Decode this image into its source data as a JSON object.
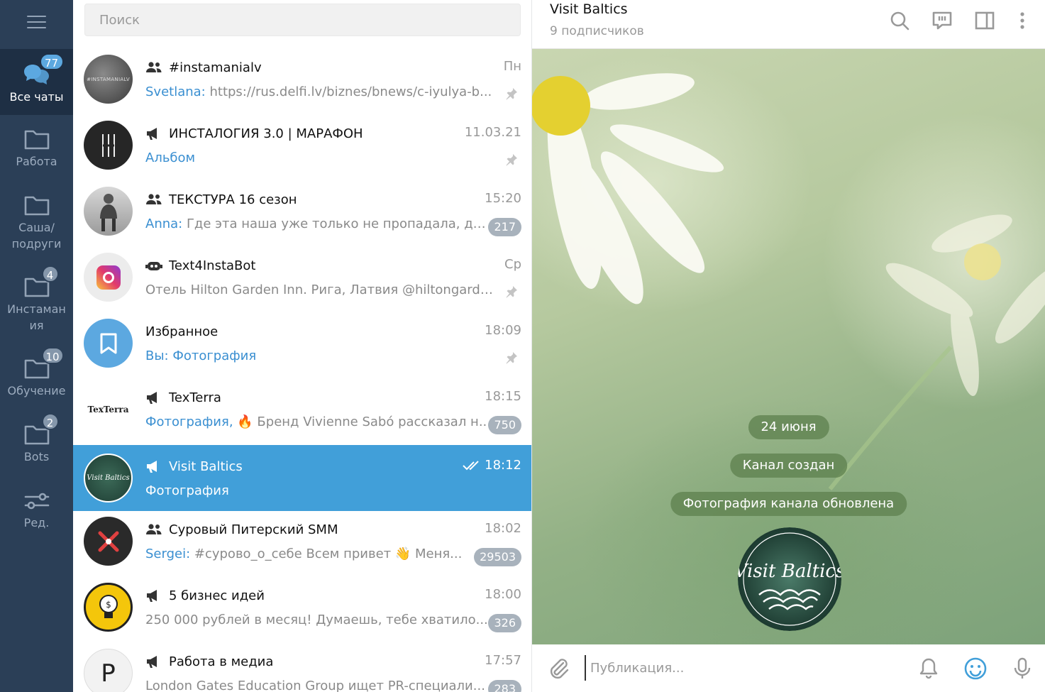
{
  "sidebar": {
    "folders": [
      {
        "label": "Все чаты",
        "badge": "77",
        "icon": "chats-icon"
      },
      {
        "label": "Работа",
        "badge": "",
        "icon": "folder-icon"
      },
      {
        "label": "Саша/ подруги",
        "badge": "",
        "icon": "folder-icon"
      },
      {
        "label": "Инстаман ия",
        "badge": "4",
        "icon": "folder-icon"
      },
      {
        "label": "Обучение",
        "badge": "10",
        "icon": "folder-icon"
      },
      {
        "label": "Bots",
        "badge": "2",
        "icon": "folder-icon"
      },
      {
        "label": "Ред.",
        "badge": "",
        "icon": "edit-folders-icon"
      }
    ]
  },
  "search": {
    "placeholder": "Поиск"
  },
  "chats": [
    {
      "title": "#instamanialv",
      "type": "group",
      "time": "Пн",
      "from": "Svetlana:",
      "preview": " https://rus.delfi.lv/biznes/bnews/c-iyulya-b...",
      "pinned": true,
      "unread": ""
    },
    {
      "title": "ИНСТАЛОГИЯ 3.0 | МАРАФОН",
      "type": "channel",
      "time": "11.03.21",
      "from": "Альбом",
      "preview": "",
      "pinned": true,
      "unread": ""
    },
    {
      "title": "ТЕКСТУРА 16 сезон",
      "type": "group",
      "time": "15:20",
      "from": "Anna:",
      "preview": " Где эта наша уже только не пропадала, да ...",
      "pinned": false,
      "unread": "217"
    },
    {
      "title": "Text4InstaBot",
      "type": "bot",
      "time": "Ср",
      "from": "",
      "preview": "Отель Hilton Garden Inn. Рига, Латвия @hiltongarde...",
      "pinned": true,
      "unread": ""
    },
    {
      "title": "Избранное",
      "type": "saved",
      "time": "18:09",
      "from": "Вы: Фотография",
      "preview": "",
      "pinned": true,
      "unread": ""
    },
    {
      "title": "TexTerra",
      "type": "channel",
      "time": "18:15",
      "from": "Фотография,",
      "preview": " 🔥 Бренд Vivienne Sabó рассказал н...",
      "pinned": false,
      "unread": "750"
    },
    {
      "title": "Visit Baltics",
      "type": "channel",
      "time": "18:12",
      "from": "",
      "preview": "Фотография",
      "pinned": false,
      "unread": "",
      "selected": true
    },
    {
      "title": "Суровый Питерский SMM",
      "type": "group",
      "time": "18:02",
      "from": "Sergei:",
      "preview": " #сурово_о_себе  Всем привет 👋  Меня...",
      "pinned": false,
      "unread": "29503"
    },
    {
      "title": "5 бизнес идей",
      "type": "channel",
      "time": "18:00",
      "from": "",
      "preview": "250 000 рублей в месяц!  Думаешь, тебе хватило...",
      "pinned": false,
      "unread": "326"
    },
    {
      "title": "Работа в медиа",
      "type": "channel",
      "time": "17:57",
      "from": "",
      "preview": "London Gates Education Group ищет PR-специали...",
      "pinned": false,
      "unread": "283"
    }
  ],
  "avatars": {
    "instamanialv": "#INSTAMANIALV",
    "texterra": "TexTerra",
    "visit_baltics": "Visit Baltics",
    "rabota_media": "P"
  },
  "conversation": {
    "title": "Visit Baltics",
    "subtitle": "9 подписчиков",
    "services": [
      "24 июня",
      "Канал создан",
      "Фотография канала обновлена"
    ],
    "composer_placeholder": "Публикация..."
  },
  "colors": {
    "sidebar_bg": "#2b3f57",
    "accent": "#419fd9",
    "badge_muted": "#a8b2bc"
  }
}
